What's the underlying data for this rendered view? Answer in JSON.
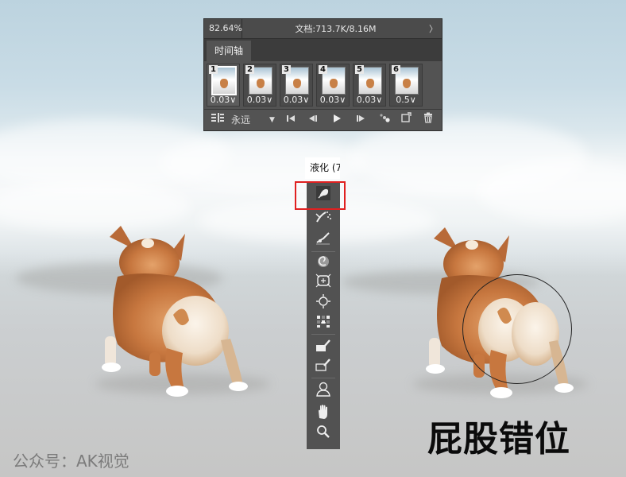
{
  "timeline_panel": {
    "zoom": "82.64%",
    "doc_info": "文档:713.7K/8.16M",
    "more_glyph": "〉",
    "tab_label": "时间轴",
    "frames": [
      {
        "number": "1",
        "delay": "0.03∨",
        "selected": true
      },
      {
        "number": "2",
        "delay": "0.03∨",
        "selected": false
      },
      {
        "number": "3",
        "delay": "0.03∨",
        "selected": false
      },
      {
        "number": "4",
        "delay": "0.03∨",
        "selected": false
      },
      {
        "number": "5",
        "delay": "0.03∨",
        "selected": false
      },
      {
        "number": "6",
        "delay": "0.5∨",
        "selected": false
      }
    ],
    "loop_label": "永远",
    "controls": [
      "timeline-options-icon",
      "loop-dropdown",
      "first-frame-icon",
      "previous-frame-icon",
      "play-icon",
      "next-frame-icon",
      "tween-icon",
      "new-frame-icon",
      "delete-icon"
    ]
  },
  "liquify_panel": {
    "title": "液化 (7",
    "tools": [
      "forward-warp-icon",
      "reconstruct-icon",
      "smooth-icon",
      "twirl-icon",
      "pucker-icon",
      "bloat-icon",
      "push-left-icon",
      "freeze-mask-icon",
      "thaw-mask-icon",
      "face-tool-icon",
      "hand-icon",
      "zoom-icon"
    ],
    "highlight_color": "#e02020"
  },
  "caption": "屁股错位",
  "watermark": "公众号：AK视觉"
}
